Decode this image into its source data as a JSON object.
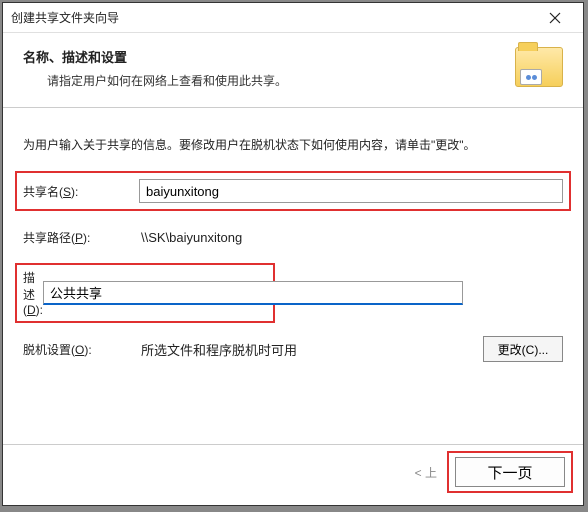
{
  "window": {
    "title": "创建共享文件夹向导"
  },
  "header": {
    "title": "名称、描述和设置",
    "subtitle": "请指定用户如何在网络上查看和使用此共享。"
  },
  "body": {
    "instruction": "为用户输入关于共享的信息。要修改用户在脱机状态下如何使用内容，请单击\"更改\"。",
    "share_name": {
      "label_main": "共享名",
      "label_key": "S",
      "label_suffix": ":",
      "value": "baiyunxitong"
    },
    "share_path": {
      "label_main": "共享路径",
      "label_key": "P",
      "label_suffix": ":",
      "value": "\\\\SK\\baiyunxitong"
    },
    "description": {
      "label_main": "描述",
      "label_key": "D",
      "label_suffix": ":",
      "value": "公共共享"
    },
    "offline": {
      "label_main": "脱机设置",
      "label_key": "O",
      "label_suffix": ":",
      "value": "所选文件和程序脱机时可用",
      "change_button": "更改(C)..."
    }
  },
  "footer": {
    "back": "< 上",
    "next": "下一页"
  }
}
